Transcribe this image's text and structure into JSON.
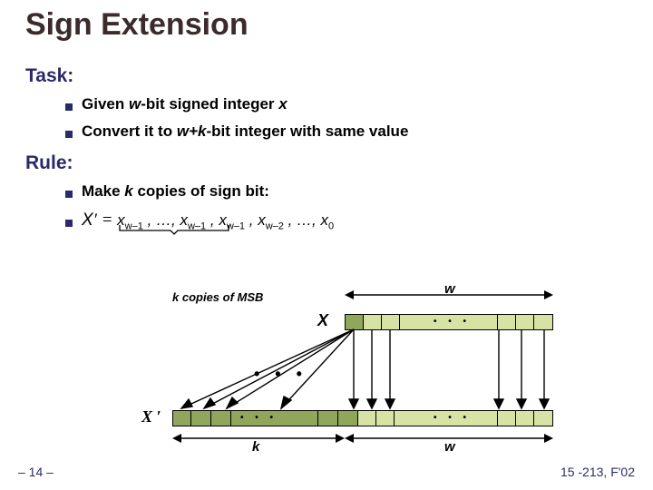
{
  "title": "Sign Extension",
  "sections": {
    "task": {
      "heading": "Task:",
      "bullets": [
        {
          "pre": "Given ",
          "ital1": "w",
          "mid1": "-bit signed integer ",
          "ital2": "x",
          "post": ""
        },
        {
          "pre": "Convert it to ",
          "ital1": "w+k",
          "mid1": "-bit integer with same value",
          "ital2": "",
          "post": ""
        }
      ]
    },
    "rule": {
      "heading": "Rule:",
      "bullets": [
        {
          "pre": "Make ",
          "ital1": "k",
          "mid1": " copies of sign bit:",
          "ital2": "",
          "post": ""
        }
      ],
      "formula": {
        "lhs_var": "X",
        "prime_eq": "′ = ",
        "terms": "x<sub>w–1</sub> , …, x<sub>w–1</sub> , x<sub>w–1</sub> , x<sub>w–2</sub> , …, x<sub>0</sub>"
      }
    }
  },
  "diagram": {
    "k_copies_label": "k copies of MSB",
    "label_X": "X",
    "label_Xprime": "X ′",
    "dim_w": "w",
    "dim_k": "k"
  },
  "footer": {
    "left": "– 14 –",
    "right": "15 -213, F'02"
  }
}
